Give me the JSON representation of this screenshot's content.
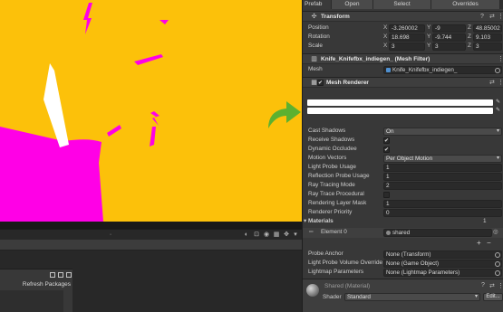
{
  "inspector": {
    "tabs": [
      "Prefab",
      "Open",
      "Select",
      "Overrides"
    ],
    "transform": {
      "title": "Transform",
      "position": {
        "label": "Position",
        "x": "-3.260002",
        "y": "-9",
        "z": "48.85002"
      },
      "rotation": {
        "label": "Rotation",
        "x": "18.698",
        "y": "-9.744",
        "z": "9.103"
      },
      "scale": {
        "label": "Scale",
        "x": "3",
        "y": "3",
        "z": "3"
      },
      "axes": [
        "X",
        "Y",
        "Z"
      ]
    },
    "mesh_filter": {
      "title": "Knife_Knifefbx_indiegen_ (Mesh Filter)",
      "mesh_label": "Mesh",
      "mesh_value": "Knife_Knifefbx_indiegen_"
    },
    "mesh_renderer": {
      "title": "Mesh Renderer",
      "properties": [
        {
          "label": "Cast Shadows",
          "type": "dropdown",
          "value": "On"
        },
        {
          "label": "Receive Shadows",
          "type": "check",
          "value": "✔"
        },
        {
          "label": "Dynamic Occludee",
          "type": "check",
          "value": "✔"
        },
        {
          "label": "Motion Vectors",
          "type": "dropdown",
          "value": "Per Object Motion"
        },
        {
          "label": "Light Probe Usage",
          "type": "field",
          "value": "1"
        },
        {
          "label": "Reflection Probe Usage",
          "type": "field",
          "value": "1"
        },
        {
          "label": "Ray Tracing Mode",
          "type": "field",
          "value": "2"
        },
        {
          "label": "Ray Trace Procedural",
          "type": "check",
          "value": ""
        },
        {
          "label": "Rendering Layer Mask",
          "type": "field",
          "value": "1"
        },
        {
          "label": "Renderer Priority",
          "type": "field",
          "value": "0"
        }
      ],
      "materials_label": "Materials",
      "materials_count": "1",
      "element_label": "Element 0",
      "element_value": "shared",
      "add_symbol": "+",
      "remove_symbol": "−",
      "probe_rows": [
        {
          "label": "Probe Anchor",
          "value": "None (Transform)"
        },
        {
          "label": "Light Probe Volume Override",
          "value": "None (Game Object)"
        },
        {
          "label": "Lightmap Parameters",
          "value": "None (Lightmap Parameters)"
        }
      ]
    },
    "material": {
      "title": "Shared (Material)",
      "shader_label": "Shader",
      "shader_value": "Standard",
      "edit_label": "Edit..."
    }
  },
  "packages": {
    "refresh_label": "Refresh Packages"
  },
  "colors": {
    "scene_background": "#fcc10a",
    "object_magenta": "#ff00e6",
    "arrow_green": "#5cb130"
  },
  "icons": [
    "transform-icon",
    "mesh-filter-icon",
    "mesh-renderer-icon",
    "eyedropper-icon",
    "settings-icon",
    "arrow-icon"
  ]
}
